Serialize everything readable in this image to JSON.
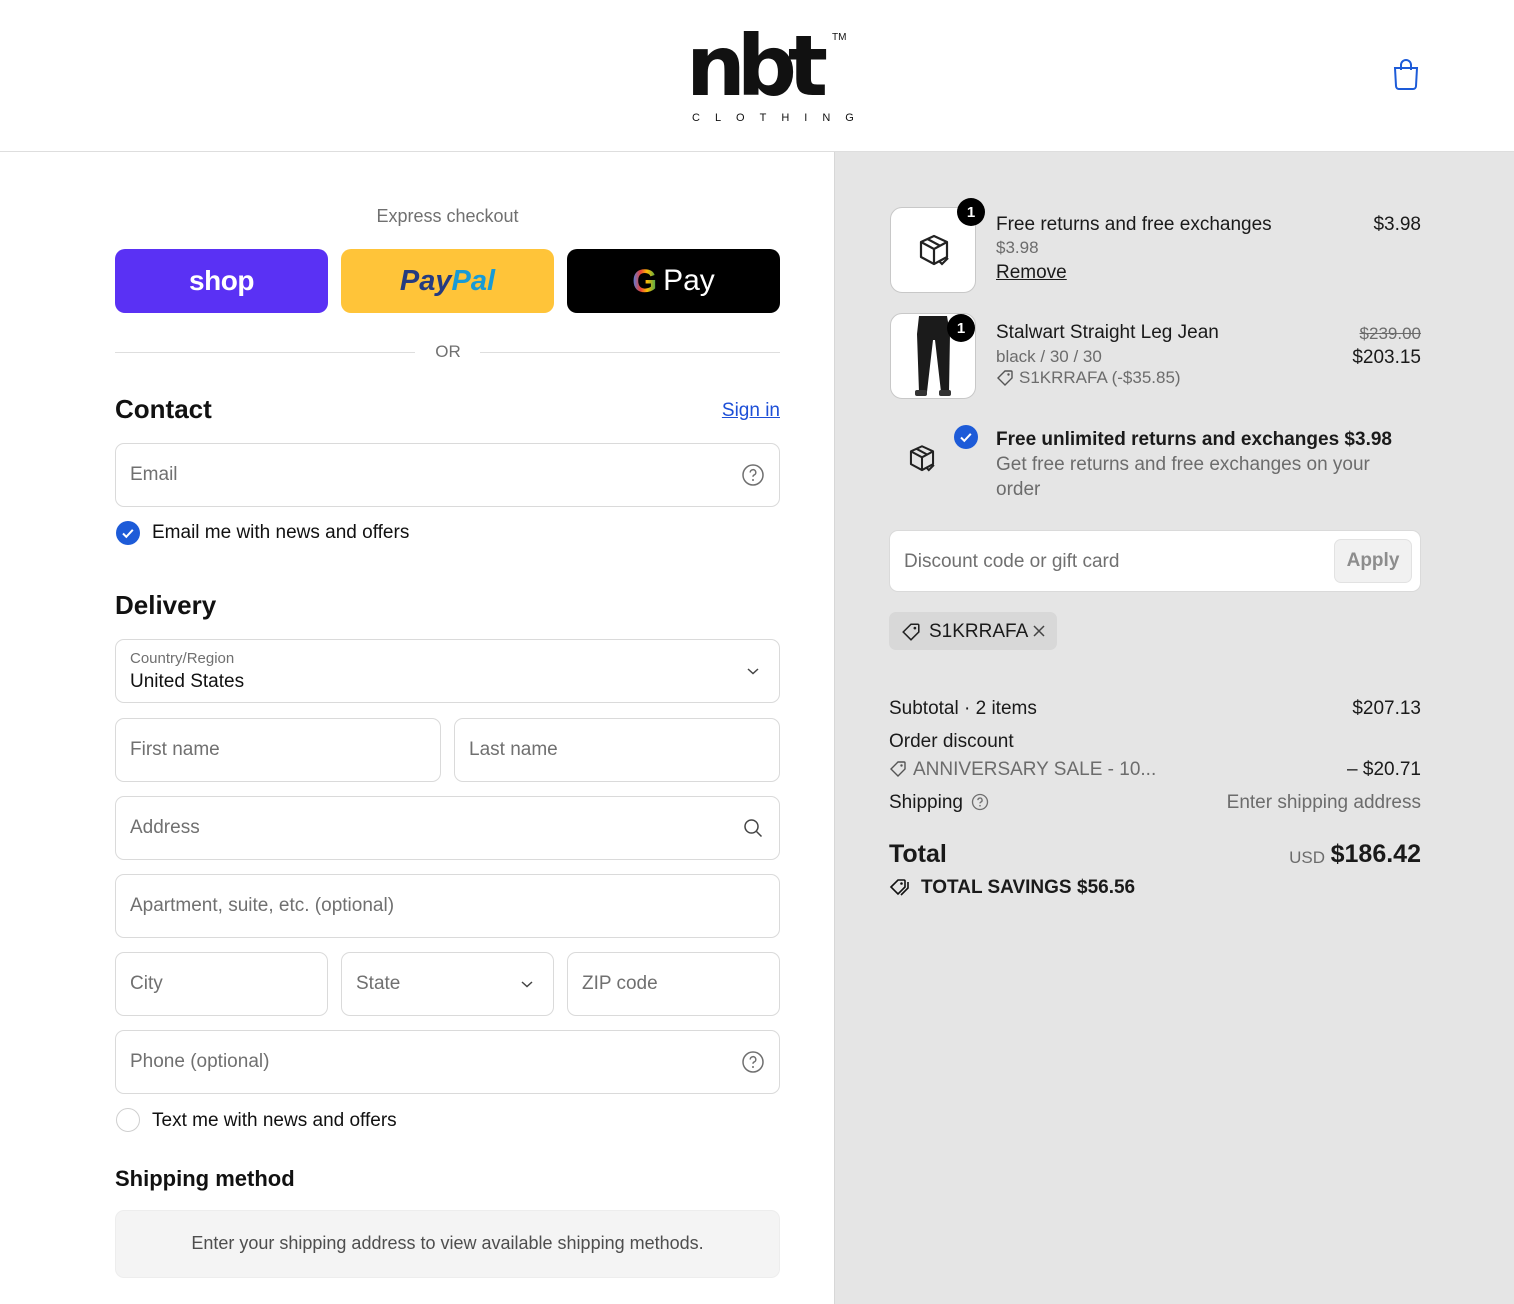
{
  "header": {
    "logo_word": "nbt",
    "logo_tm": "TM",
    "logo_sub": "CLOTHING",
    "cart_icon": "shopping-bag-icon"
  },
  "express": {
    "title": "Express checkout",
    "shop_label": "shop",
    "paypal_label_1": "Pay",
    "paypal_label_2": "Pal",
    "gpay_g": "G",
    "gpay_label": "Pay",
    "or_label": "OR"
  },
  "contact": {
    "heading": "Contact",
    "signin_label": "Sign in",
    "email_placeholder": "Email",
    "news_checkbox_label": "Email me with news and offers",
    "news_checked": true
  },
  "delivery": {
    "heading": "Delivery",
    "country_label": "Country/Region",
    "country_value": "United States",
    "first_name_placeholder": "First name",
    "last_name_placeholder": "Last name",
    "address_placeholder": "Address",
    "apartment_placeholder": "Apartment, suite, etc. (optional)",
    "city_placeholder": "City",
    "state_placeholder": "State",
    "zip_placeholder": "ZIP code",
    "phone_placeholder": "Phone (optional)",
    "text_checkbox_label": "Text me with news and offers",
    "text_checked": false
  },
  "shipping_method": {
    "heading": "Shipping method",
    "message": "Enter your shipping address to view available shipping methods."
  },
  "summary": {
    "items": [
      {
        "qty": "1",
        "title": "Free returns and free exchanges",
        "sub": "$3.98",
        "action": "Remove",
        "price": "$3.98",
        "icon": "box-check-icon"
      },
      {
        "qty": "1",
        "title": "Stalwart Straight Leg Jean",
        "sub": "black / 30 / 30",
        "discount": "S1KRRAFA (-$35.85)",
        "original_price": "$239.00",
        "price": "$203.15"
      }
    ],
    "upsell": {
      "title": "Free unlimited returns and exchanges $3.98",
      "desc_line1": "Get free returns and free exchanges on your",
      "desc_line2": "order",
      "checked": true
    },
    "discount_placeholder": "Discount code or gift card",
    "apply_label": "Apply",
    "applied_code": "S1KRRAFA",
    "subtotal_label": "Subtotal · 2 items",
    "subtotal_value": "$207.13",
    "order_discount_label": "Order discount",
    "order_discount_code": "ANNIVERSARY SALE - 10...",
    "order_discount_value": "– $20.71",
    "shipping_label": "Shipping",
    "shipping_value": "Enter shipping address",
    "total_label": "Total",
    "total_currency": "USD",
    "total_value": "$186.42",
    "savings_label": "TOTAL SAVINGS",
    "savings_value": "$56.56"
  },
  "colors": {
    "accent": "#1d5bd8",
    "shop": "#5a31f4",
    "paypal": "#ffc439",
    "summary_bg": "#e5e5e5"
  }
}
